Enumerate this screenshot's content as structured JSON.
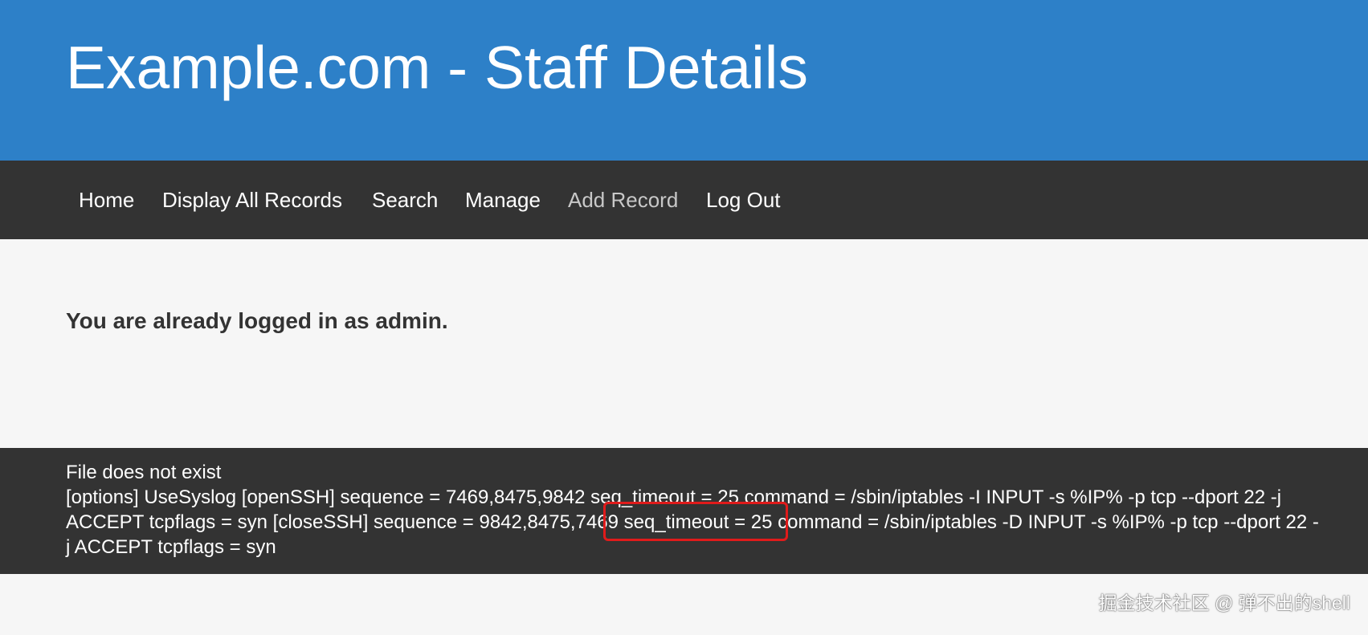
{
  "header": {
    "title": "Example.com - Staff Details",
    "bg_color": "#2d80c8"
  },
  "nav": {
    "items": [
      {
        "label": "Home"
      },
      {
        "label": "Display All Records"
      },
      {
        "label": "Search"
      },
      {
        "label": "Manage"
      },
      {
        "label": "Add Record",
        "active": true
      },
      {
        "label": "Log Out"
      }
    ]
  },
  "main": {
    "message": "You are already logged in as admin."
  },
  "footer": {
    "line1": "File does not exist",
    "line2": "[options] UseSyslog [openSSH] sequence = 7469,8475,9842 seq_timeout = 25 command = /sbin/iptables -I INPUT -s %IP% -p tcp --dport 22 -j ACCEPT tcpflags = syn [closeSSH] sequence = 9842,8475,7469 seq_timeout = 25 command = /sbin/iptables -D INPUT -s %IP% -p tcp --dport 22 -j ACCEPT tcpflags = syn"
  },
  "annotation": {
    "color": "#e01b1b"
  },
  "watermark": {
    "text": "掘金技术社区 @ 弹不出的shell"
  }
}
